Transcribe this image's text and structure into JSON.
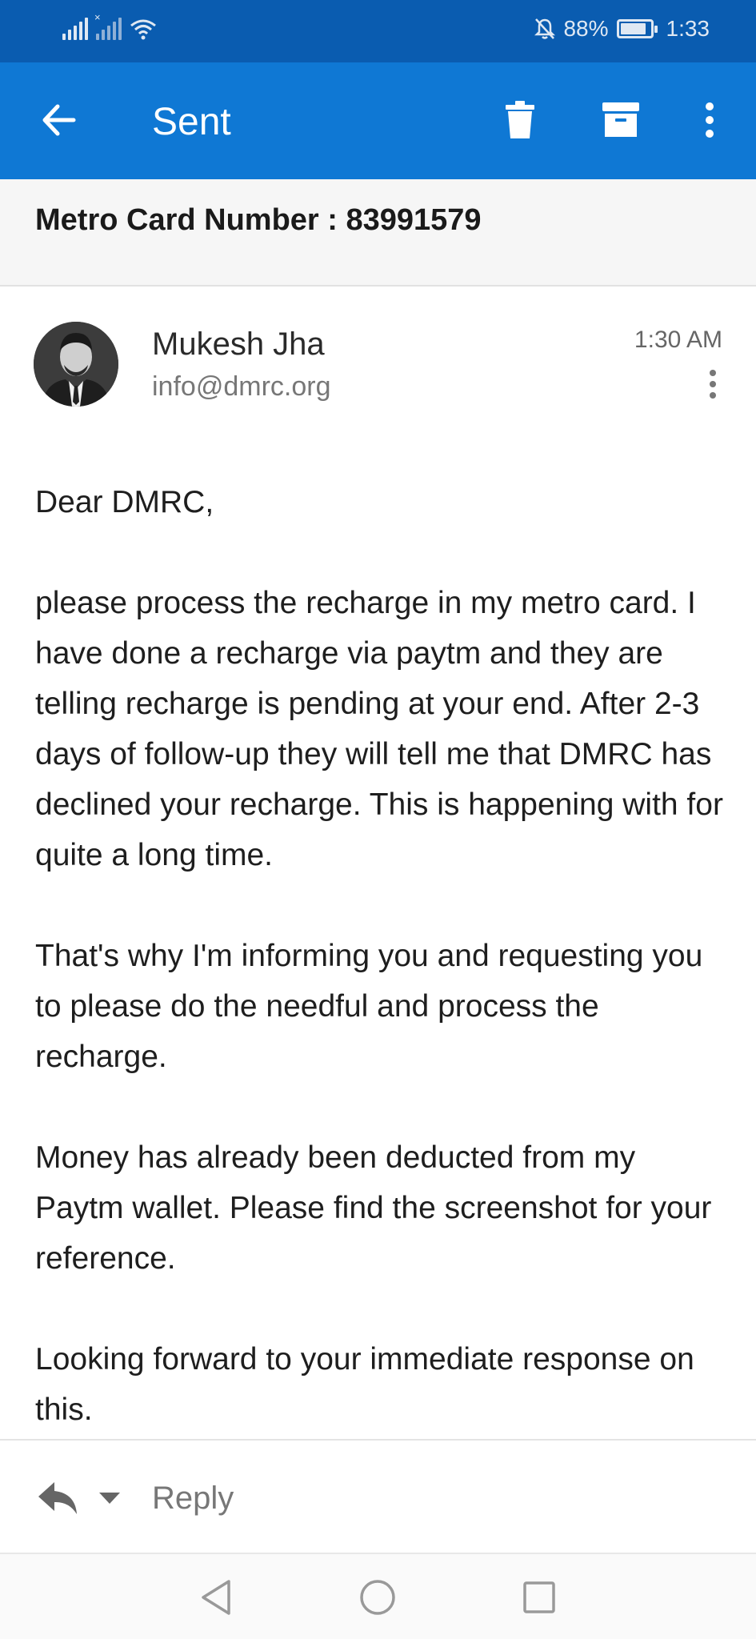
{
  "status_bar": {
    "battery_percent": "88%",
    "battery_level": 0.88,
    "time": "1:33"
  },
  "app_bar": {
    "title": "Sent",
    "back_icon": "arrow-left-icon",
    "actions": [
      "trash-icon",
      "archive-icon",
      "more-vertical-icon"
    ]
  },
  "email": {
    "subject": "Metro Card Number : 83991579",
    "sender_name": "Mukesh Jha",
    "sender_email": "info@dmrc.org",
    "time": "1:30 AM",
    "body": {
      "greeting": "Dear DMRC,",
      "p1": "please process the recharge in my metro card. I have done a recharge via paytm and they are telling recharge is pending at your end. After 2-3 days of follow-up they will tell me that DMRC has declined your recharge. This is happening with for quite a long time.",
      "p2": "That's why I'm informing you and requesting you to please do the needful and process the recharge.",
      "p3": "Money has already been deducted from my Paytm wallet. Please find the screenshot for your reference.",
      "p4": "Looking forward to your immediate response on this."
    }
  },
  "reply_bar": {
    "label": "Reply"
  },
  "colors": {
    "status_bar": "#0a5cb0",
    "app_bar": "#0f78d4"
  }
}
